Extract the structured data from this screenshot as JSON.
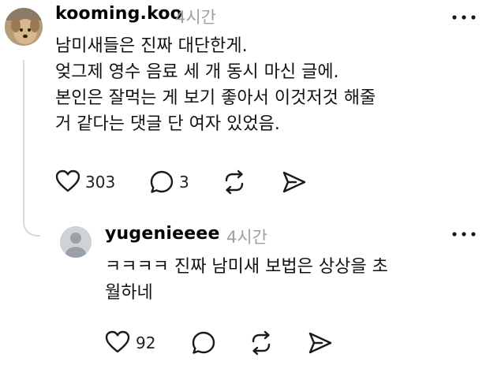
{
  "post": {
    "username": "kooming.koo",
    "time": "4시간",
    "text": "남미새들은 진짜 대단한게.\n엊그제 영수 음료 세 개 동시 마신 글에.\n본인은 잘먹는 게 보기 좋아서 이것저것 해줄\n거 같다는 댓글 단 여자 있었음.",
    "likes": "303",
    "replies": "3",
    "icons": [
      "heart-icon",
      "comment-icon",
      "repost-icon",
      "share-icon",
      "more-icon"
    ]
  },
  "reply": {
    "username": "yugenieeee",
    "time": "4시간",
    "text": "ㅋㅋㅋㅋ 진짜 남미새 보법은 상상을 초\n월하네",
    "likes": "92",
    "icons": [
      "heart-icon",
      "comment-icon",
      "repost-icon",
      "share-icon",
      "more-icon"
    ]
  },
  "colors": {
    "muted": "#a0a0a0",
    "thread_line": "#d9d9d9",
    "icon": "#1a1a1a"
  }
}
